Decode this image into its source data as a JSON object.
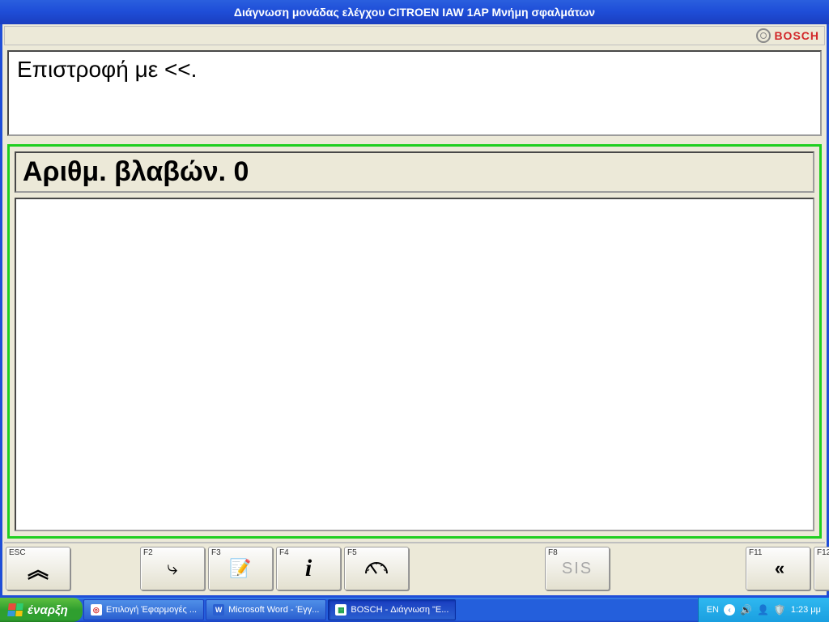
{
  "titlebar": "Διάγνωση μονάδας ελέγχου  CITROEN  IAW 1AP  Μνήμη σφαλμάτων",
  "brand": "BOSCH",
  "message": "Επιστροφή με <<.",
  "fault_header": "Αριθμ. βλαβών. 0",
  "fkeys": {
    "esc": "ESC",
    "f2": "F2",
    "f3": "F3",
    "f4": "F4",
    "f5": "F5",
    "f8": "F8",
    "f8_label": "SIS",
    "f11": "F11",
    "f12": "F12"
  },
  "taskbar": {
    "start": "έναρξη",
    "items": [
      "Επιλογή Έφαρμογές ...",
      "Microsoft Word - Έγγ...",
      "BOSCH - Διάγνωση \"Ε..."
    ],
    "lang": "EN",
    "time": "1:23 μμ"
  }
}
